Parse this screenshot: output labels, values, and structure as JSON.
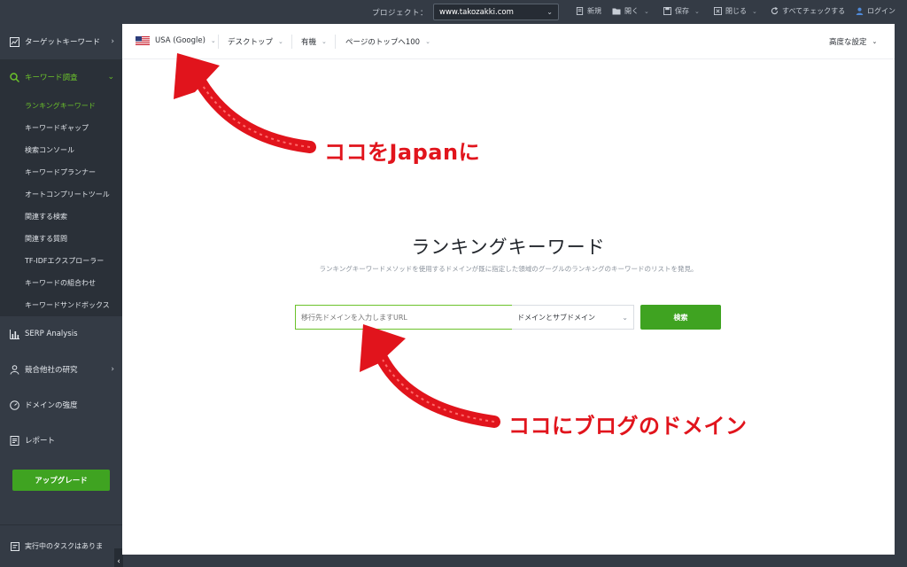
{
  "topbar": {
    "project_label": "プロジェクト：",
    "project_value": "www.takozakki.com",
    "menu": {
      "new": "新規",
      "open": "開く",
      "save": "保存",
      "close": "閉じる",
      "check_all": "すべてチェックする",
      "login": "ログイン"
    }
  },
  "sidebar": {
    "target_keywords": "ターゲットキーワード",
    "keyword_research": "キーワード調査",
    "sub_items": [
      "ランキングキーワード",
      "キーワードギャップ",
      "検索コンソール",
      "キーワードプランナー",
      "オートコンプリートツール",
      "関連する検索",
      "関連する質問",
      "TF-IDFエクスプローラー",
      "キーワードの組合わせ",
      "キーワードサンドボックス"
    ],
    "serp_analysis": "SERP Analysis",
    "competitor_research": "競合他社の研究",
    "domain_strength": "ドメインの強度",
    "report": "レポート",
    "upgrade": "アップグレード",
    "tasks": "実行中のタスクはありま"
  },
  "filters": {
    "country": "USA (Google)",
    "device": "デスクトップ",
    "type": "有機",
    "range": "ページのトップへ100",
    "advanced": "高度な設定"
  },
  "main": {
    "title": "ランキングキーワード",
    "description": "ランキングキーワードメソッドを使用するドメインが既に指定した領域のグーグルのランキングのキーワードのリストを発見。",
    "input_placeholder": "移行先ドメインを入力しますURL",
    "scope_value": "ドメインとサブドメイン",
    "search_button": "検索"
  },
  "annotations": {
    "top": "ココをJapanに",
    "bottom": "ココにブログのドメイン"
  },
  "colors": {
    "accent_green": "#6bc22b",
    "button_green": "#3fa321",
    "annotation_red": "#e1141c",
    "sidebar_bg": "#343b45"
  }
}
